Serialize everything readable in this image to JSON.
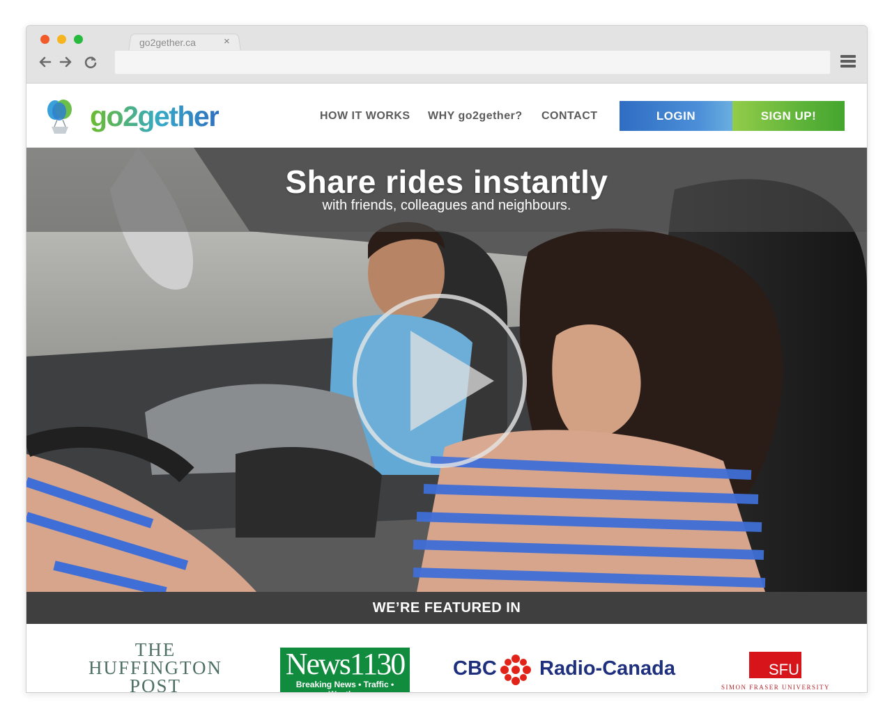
{
  "browser": {
    "tab_title": "go2gether.ca",
    "tab_close": "×",
    "address": "",
    "icons": [
      "back-icon",
      "forward-icon",
      "reload-icon",
      "menu-icon"
    ]
  },
  "site": {
    "logo_text": "go2gether",
    "nav": [
      "HOW IT WORKS",
      "WHY go2gether?",
      "CONTACT"
    ],
    "login_label": "LOGIN",
    "signup_label": "SIGN UP!",
    "colors": {
      "login": "#2f6dc2",
      "signup": "#5fb43a",
      "featured_bar": "#3f3f3f"
    }
  },
  "hero": {
    "title": "Share rides instantly",
    "subtitle": "with friends, colleagues and neighbours.",
    "play_icon": "play-icon"
  },
  "featured": {
    "heading": "WE’RE FEATURED IN",
    "huffington": [
      "THE",
      "HUFFINGTON",
      "POST"
    ],
    "news1130": {
      "name": "News1130",
      "tagline": "Breaking News • Traffic • Weather"
    },
    "cbc": {
      "cbc": "CBC",
      "radio_canada": "Radio-Canada"
    },
    "sfu": {
      "abbr": "SFU",
      "name": "SIMON FRASER UNIVERSITY"
    }
  }
}
